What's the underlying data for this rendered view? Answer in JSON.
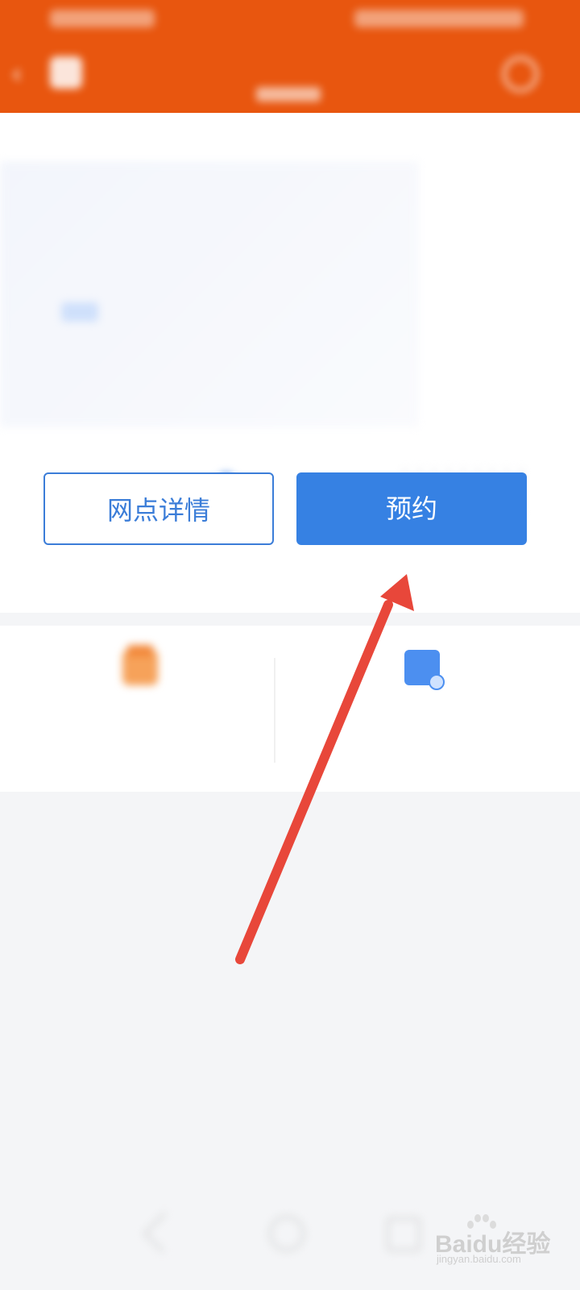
{
  "header": {
    "background_color": "#e8560f",
    "back_icon": "chevron-left-icon",
    "nav_left_label": "",
    "title": "",
    "right_icon": "circle-icon"
  },
  "branch": {
    "name": "",
    "address": "",
    "link_label": ""
  },
  "actions": {
    "detail_label": "网点详情",
    "reserve_label": "预约",
    "reserve_color": "#3681e3"
  },
  "features": [
    {
      "icon": "shop-icon",
      "title": "",
      "desc": ""
    },
    {
      "icon": "document-clock-icon",
      "title": "",
      "desc": ""
    }
  ],
  "watermark": {
    "brand": "Baidu经验",
    "url": "jingyan.baidu.com"
  },
  "annotation": {
    "arrow_color": "#e8473a",
    "arrow_target": "reserve-button"
  }
}
